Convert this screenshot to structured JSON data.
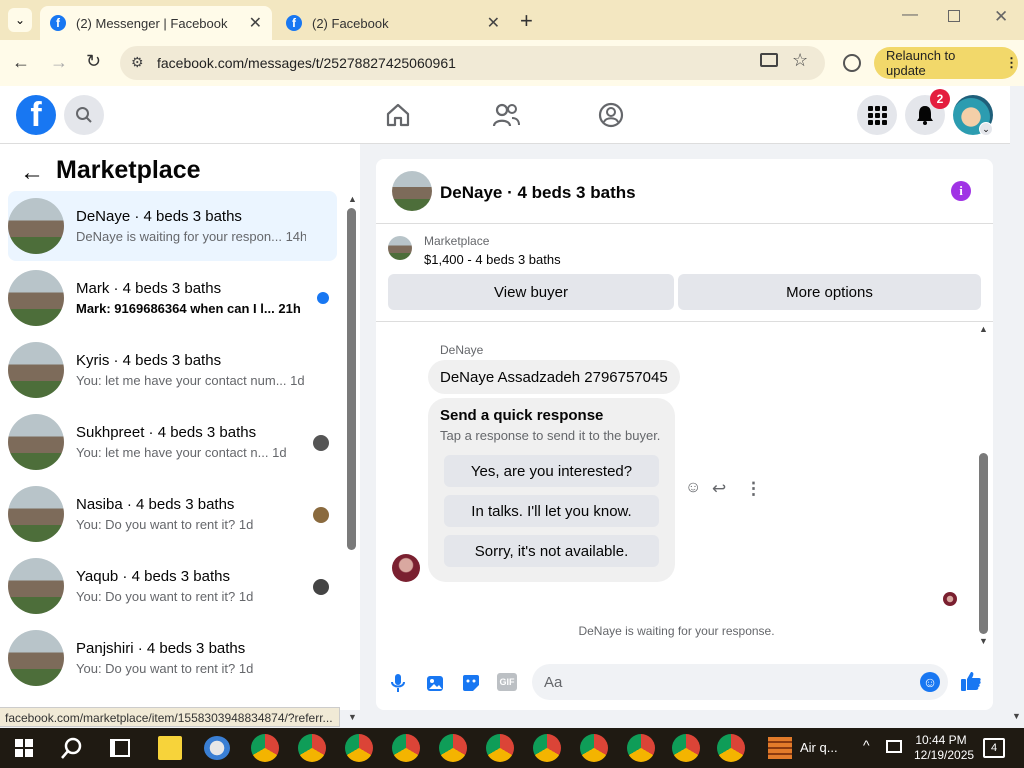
{
  "browser": {
    "tabs": [
      {
        "title": "(2) Messenger | Facebook",
        "active": true
      },
      {
        "title": "(2) Facebook",
        "active": false
      }
    ],
    "url": "facebook.com/messages/t/25278827425060961",
    "relaunch_label": "Relaunch to update",
    "status_url": "facebook.com/marketplace/item/1558303948834874/?referr..."
  },
  "nav": {
    "notification_count": "2"
  },
  "left": {
    "title": "Marketplace",
    "conversations": [
      {
        "name": "DeNaye · 4 beds 3 baths",
        "preview": "DeNaye is waiting for your respon...",
        "time": "14h"
      },
      {
        "name": "Mark · 4 beds 3 baths",
        "preview": "Mark: 9169686364 when can I l...",
        "time": "21h"
      },
      {
        "name": "Kyris · 4 beds 3 baths",
        "preview": "You: let me have your contact num...",
        "time": "1d"
      },
      {
        "name": "Sukhpreet · 4 beds 3 baths",
        "preview": "You: let me have your contact n...",
        "time": "1d"
      },
      {
        "name": "Nasiba · 4 beds 3 baths",
        "preview": "You: Do you want to rent it?",
        "time": "1d"
      },
      {
        "name": "Yaqub · 4 beds 3 baths",
        "preview": "You: Do you want to rent it?",
        "time": "1d"
      },
      {
        "name": "Panjshiri · 4 beds 3 baths",
        "preview": "You: Do you want to rent it?",
        "time": "1d"
      }
    ]
  },
  "chat": {
    "title": "DeNaye · 4 beds 3 baths",
    "listing_source": "Marketplace",
    "listing_title": "$1,400 - 4 beds 3 baths",
    "view_buyer": "View buyer",
    "more_options": "More options",
    "sender": "DeNaye",
    "message": "DeNaye Assadzadeh 2796757045",
    "quick_title": "Send a quick response",
    "quick_sub": "Tap a response to send it to the buyer.",
    "quick_responses": [
      "Yes, are you interested?",
      "In talks. I'll let you know.",
      "Sorry, it's not available."
    ],
    "waiting": "DeNaye is waiting for your response.",
    "input_placeholder": "Aa"
  },
  "taskbar": {
    "app_label": "Air q...",
    "time": "10:44 PM",
    "date": "12/19/2025",
    "notif_count": "4"
  },
  "colors": {
    "fb_blue": "#1877f2",
    "purple_info": "#a033e5",
    "selected_row": "#ebf5ff"
  }
}
